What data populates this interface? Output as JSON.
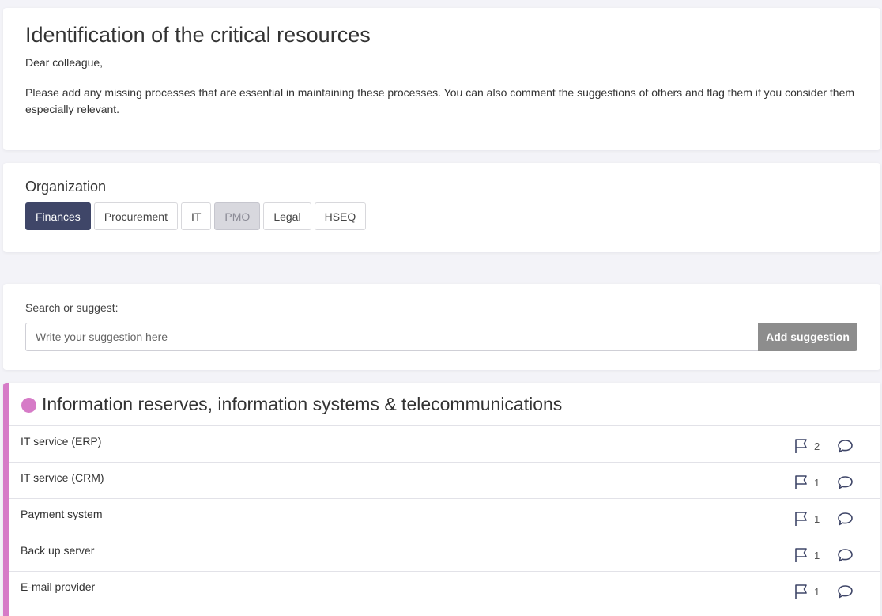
{
  "intro": {
    "title": "Identification of the critical resources",
    "greeting": "Dear colleague,",
    "body": "Please add any missing processes that are essential in maintaining these processes. You can also comment the suggestions of others and flag them if you consider them especially relevant."
  },
  "organization": {
    "heading": "Organization",
    "tabs": [
      {
        "label": "Finances",
        "state": "active"
      },
      {
        "label": "Procurement",
        "state": "normal"
      },
      {
        "label": "IT",
        "state": "normal"
      },
      {
        "label": "PMO",
        "state": "muted"
      },
      {
        "label": "Legal",
        "state": "normal"
      },
      {
        "label": "HSEQ",
        "state": "normal"
      }
    ]
  },
  "search": {
    "label": "Search or suggest:",
    "placeholder": "Write your suggestion here",
    "button_label": "Add suggestion"
  },
  "resources": {
    "title": "Information reserves, information systems & telecommunications",
    "accent_color": "#d67bc7",
    "items": [
      {
        "name": "IT service (ERP)",
        "flags": "2"
      },
      {
        "name": "IT service (CRM)",
        "flags": "1"
      },
      {
        "name": "Payment system",
        "flags": "1"
      },
      {
        "name": "Back up server",
        "flags": "1"
      },
      {
        "name": "E-mail provider",
        "flags": "1"
      }
    ]
  },
  "icons": {
    "flag": "flag-icon",
    "comment": "comment-icon"
  }
}
